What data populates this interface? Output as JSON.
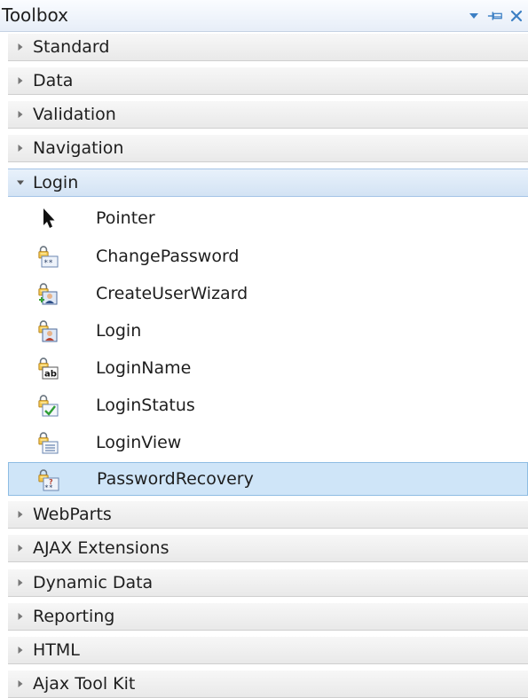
{
  "window": {
    "title": "Toolbox",
    "buttons": [
      {
        "icon": "dropdown-arrow-icon"
      },
      {
        "icon": "pin-icon"
      },
      {
        "icon": "close-icon"
      }
    ]
  },
  "categories_top": [
    {
      "label": "Standard",
      "expanded": false
    },
    {
      "label": "Data",
      "expanded": false
    },
    {
      "label": "Validation",
      "expanded": false
    },
    {
      "label": "Navigation",
      "expanded": false
    },
    {
      "label": "Login",
      "expanded": true
    }
  ],
  "login_items": [
    {
      "label": "Pointer",
      "icon": "pointer-arrow-icon",
      "selected": false
    },
    {
      "label": "ChangePassword",
      "icon": "change-password-icon",
      "selected": false
    },
    {
      "label": "CreateUserWizard",
      "icon": "create-user-wizard-icon",
      "selected": false
    },
    {
      "label": "Login",
      "icon": "login-control-icon",
      "selected": false
    },
    {
      "label": "LoginName",
      "icon": "login-name-icon",
      "selected": false
    },
    {
      "label": "LoginStatus",
      "icon": "login-status-icon",
      "selected": false
    },
    {
      "label": "LoginView",
      "icon": "login-view-icon",
      "selected": false
    },
    {
      "label": "PasswordRecovery",
      "icon": "password-recovery-icon",
      "selected": true
    }
  ],
  "categories_bottom": [
    {
      "label": "WebParts",
      "expanded": false
    },
    {
      "label": "AJAX Extensions",
      "expanded": false
    },
    {
      "label": "Dynamic Data",
      "expanded": false
    },
    {
      "label": "Reporting",
      "expanded": false
    },
    {
      "label": "HTML",
      "expanded": false
    },
    {
      "label": "Ajax Tool Kit",
      "expanded": false
    }
  ],
  "colors": {
    "accent": "#3c9cdc",
    "selection_bg": "#cfe5f8",
    "selection_border": "#8fbde3",
    "close_red": "#d03434"
  }
}
